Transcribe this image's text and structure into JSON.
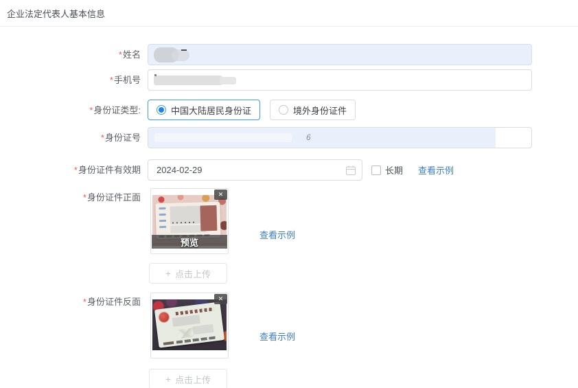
{
  "header": {
    "title": "企业法定代表人基本信息"
  },
  "required_marker": "*",
  "icons": {
    "close": "✕",
    "plus": "+"
  },
  "fields": {
    "name": {
      "label": "姓名"
    },
    "phone": {
      "label": "手机号"
    },
    "id_type": {
      "label": "身份证类型:",
      "options": [
        {
          "label": "中国大陆居民身份证",
          "selected": true
        },
        {
          "label": "境外身份证件",
          "selected": false
        }
      ]
    },
    "id_number": {
      "label": "身份证号",
      "visible_char": "6"
    },
    "validity": {
      "label": "身份证件有效期",
      "date_value": "2024-02-29",
      "long_term_label": "长期",
      "long_term_checked": false,
      "example_link_label": "查看示例"
    },
    "id_front": {
      "label": "身份证件正面",
      "preview_label": "预览",
      "example_link_label": "查看示例"
    },
    "id_back": {
      "label": "身份证件反面",
      "example_link_label": "查看示例"
    }
  },
  "upload_button": {
    "label": "点击上传"
  },
  "colors": {
    "link_blue": "#3d7ec9",
    "radio_selected_blue": "#3f9bf3",
    "required_red": "#f25b5b",
    "readonly_field_blue": "#e9f0fb"
  }
}
